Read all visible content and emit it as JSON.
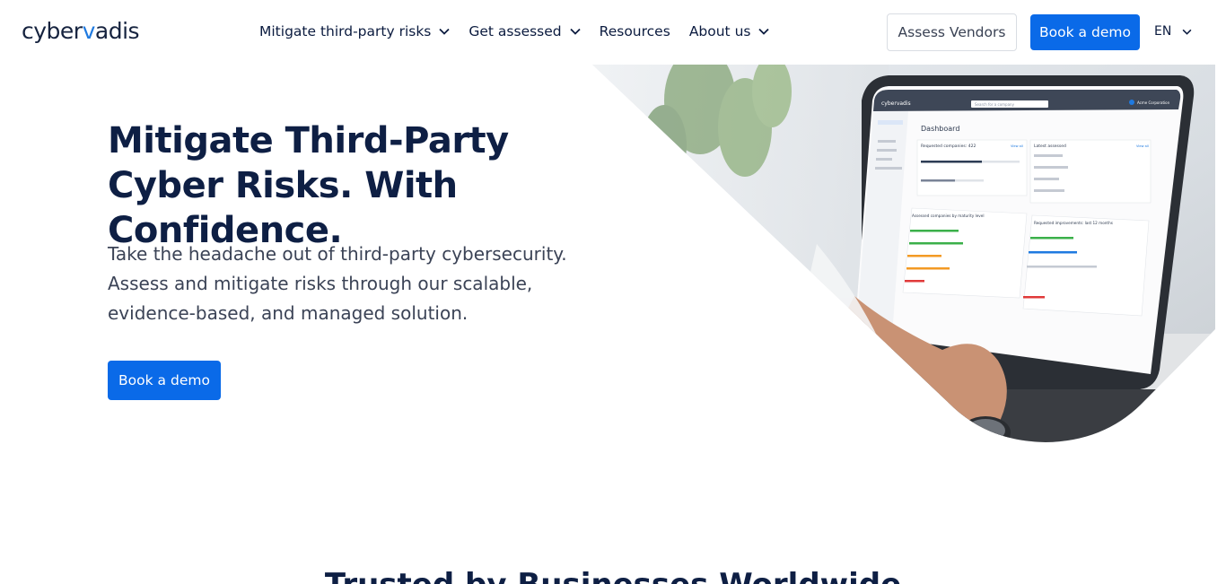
{
  "header": {
    "logo_left": "cyber",
    "logo_accent": "v",
    "logo_right": "adis",
    "nav": [
      {
        "label": "Mitigate third-party risks",
        "has_dropdown": true
      },
      {
        "label": "Get assessed",
        "has_dropdown": true
      },
      {
        "label": "Resources",
        "has_dropdown": false
      },
      {
        "label": "About us",
        "has_dropdown": true
      }
    ],
    "assess_vendors_label": "Assess Vendors",
    "book_demo_label": "Book a demo",
    "language": "EN"
  },
  "hero": {
    "title": "Mitigate Third-Party Cyber Risks. With Confidence.",
    "subtitle": "Take the headache out of third-party cybersecurity. Assess and mitigate risks through our scalable, evidence-based, and managed solution.",
    "cta_label": "Book a demo"
  },
  "dashboard": {
    "app_name": "cybervadis",
    "search_placeholder": "Search for a company",
    "account": "Acme Corporation",
    "title": "Dashboard",
    "requested_companies": "Requested companies: 422",
    "latest_assessed": "Latest assessed",
    "maturity_title": "Assessed companies by maturity level",
    "improvements_title": "Requested improvements: last 12 months",
    "view_all": "View all"
  },
  "section": {
    "trusted_title": "Trusted by Businesses Worldwide"
  },
  "colors": {
    "primary": "#0a6ae8",
    "heading": "#0e1f44",
    "body_text": "#3b4356"
  }
}
